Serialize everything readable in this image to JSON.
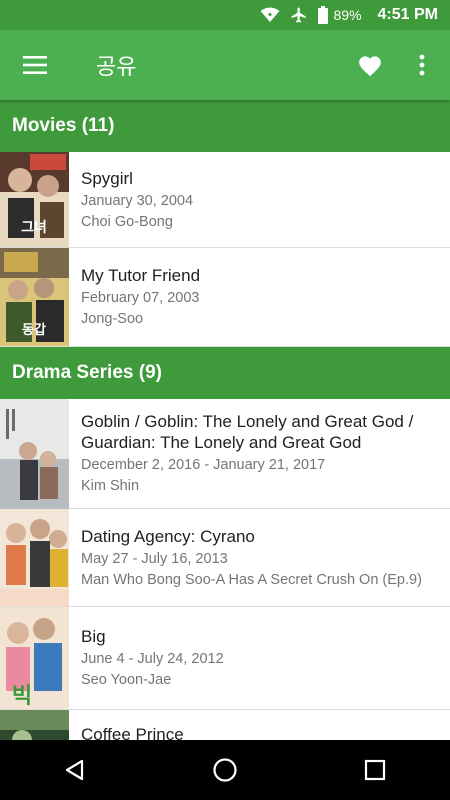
{
  "status_bar": {
    "battery": "89%",
    "time": "4:51 PM",
    "icons": [
      "wifi-icon",
      "airplane-icon",
      "battery-icon"
    ]
  },
  "app_bar": {
    "title": "공유",
    "icons": [
      "menu-icon",
      "heart-icon",
      "more-vert-icon"
    ]
  },
  "sections": [
    {
      "header": "Movies (11)",
      "items": [
        {
          "title": "Spygirl",
          "date": "January 30, 2004",
          "role": "Choi Go-Bong",
          "poster_colors": [
            "#5a3a2c",
            "#c94a3a",
            "#e9d9c0"
          ]
        },
        {
          "title": "My Tutor Friend",
          "date": "February 07, 2003",
          "role": "Jong-Soo",
          "poster_colors": [
            "#7a6a4a",
            "#3e5a2a",
            "#d9c47a"
          ]
        }
      ]
    },
    {
      "header": "Drama Series (9)",
      "items": [
        {
          "title": "Goblin / Goblin: The Lonely and Great God / Guardian: The Lonely and Great God",
          "date": "December 2, 2016 - January 21, 2017",
          "role": "Kim Shin",
          "poster_colors": [
            "#e8e8e6",
            "#b7bcc0",
            "#6a6a72"
          ]
        },
        {
          "title": "Dating Agency: Cyrano",
          "date": "May 27 - July 16, 2013",
          "role": "Man Who Bong Soo-A Has A Secret Crush On (Ep.9)",
          "poster_colors": [
            "#f2e6d8",
            "#e07a4a",
            "#3a3a3a"
          ]
        },
        {
          "title": "Big",
          "date": "June 4 - July 24, 2012",
          "role": "Seo Yoon-Jae",
          "poster_colors": [
            "#f3e3d3",
            "#e98aa0",
            "#3c7ac0"
          ]
        },
        {
          "title": "Coffee Prince",
          "date": "",
          "role": "",
          "poster_colors": [
            "#2e4a2e",
            "#6a8a5a",
            "#a8c090"
          ]
        }
      ]
    }
  ],
  "nav_bar": {
    "icons": [
      "back-icon",
      "home-icon",
      "recents-icon"
    ]
  }
}
